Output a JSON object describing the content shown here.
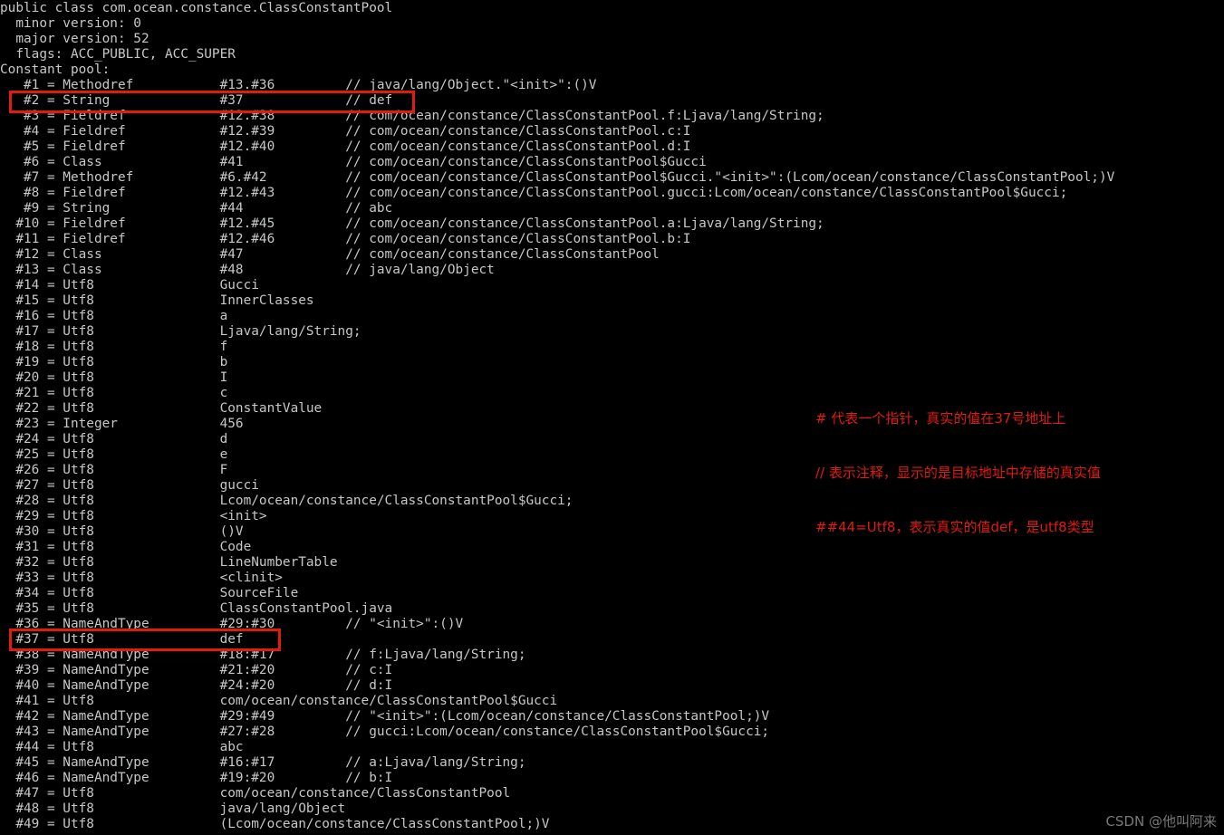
{
  "terminal": {
    "background_color": "#000000",
    "text_color": "#c5c8c6",
    "header_lines": [
      "public class com.ocean.constance.ClassConstantPool",
      "  minor version: 0",
      "  major version: 52",
      "  flags: ACC_PUBLIC, ACC_SUPER",
      "Constant pool:"
    ],
    "constant_pool": [
      {
        "index": "#1",
        "type": "Methodref",
        "ref": "#13.#36",
        "comment": "// java/lang/Object.\"<init>\":()V"
      },
      {
        "index": "#2",
        "type": "String",
        "ref": "#37",
        "comment": "// def"
      },
      {
        "index": "#3",
        "type": "Fieldref",
        "ref": "#12.#38",
        "comment": "// com/ocean/constance/ClassConstantPool.f:Ljava/lang/String;"
      },
      {
        "index": "#4",
        "type": "Fieldref",
        "ref": "#12.#39",
        "comment": "// com/ocean/constance/ClassConstantPool.c:I"
      },
      {
        "index": "#5",
        "type": "Fieldref",
        "ref": "#12.#40",
        "comment": "// com/ocean/constance/ClassConstantPool.d:I"
      },
      {
        "index": "#6",
        "type": "Class",
        "ref": "#41",
        "comment": "// com/ocean/constance/ClassConstantPool$Gucci"
      },
      {
        "index": "#7",
        "type": "Methodref",
        "ref": "#6.#42",
        "comment": "// com/ocean/constance/ClassConstantPool$Gucci.\"<init>\":(Lcom/ocean/constance/ClassConstantPool;)V"
      },
      {
        "index": "#8",
        "type": "Fieldref",
        "ref": "#12.#43",
        "comment": "// com/ocean/constance/ClassConstantPool.gucci:Lcom/ocean/constance/ClassConstantPool$Gucci;"
      },
      {
        "index": "#9",
        "type": "String",
        "ref": "#44",
        "comment": "// abc"
      },
      {
        "index": "#10",
        "type": "Fieldref",
        "ref": "#12.#45",
        "comment": "// com/ocean/constance/ClassConstantPool.a:Ljava/lang/String;"
      },
      {
        "index": "#11",
        "type": "Fieldref",
        "ref": "#12.#46",
        "comment": "// com/ocean/constance/ClassConstantPool.b:I"
      },
      {
        "index": "#12",
        "type": "Class",
        "ref": "#47",
        "comment": "// com/ocean/constance/ClassConstantPool"
      },
      {
        "index": "#13",
        "type": "Class",
        "ref": "#48",
        "comment": "// java/lang/Object"
      },
      {
        "index": "#14",
        "type": "Utf8",
        "ref": "Gucci",
        "comment": ""
      },
      {
        "index": "#15",
        "type": "Utf8",
        "ref": "InnerClasses",
        "comment": ""
      },
      {
        "index": "#16",
        "type": "Utf8",
        "ref": "a",
        "comment": ""
      },
      {
        "index": "#17",
        "type": "Utf8",
        "ref": "Ljava/lang/String;",
        "comment": ""
      },
      {
        "index": "#18",
        "type": "Utf8",
        "ref": "f",
        "comment": ""
      },
      {
        "index": "#19",
        "type": "Utf8",
        "ref": "b",
        "comment": ""
      },
      {
        "index": "#20",
        "type": "Utf8",
        "ref": "I",
        "comment": ""
      },
      {
        "index": "#21",
        "type": "Utf8",
        "ref": "c",
        "comment": ""
      },
      {
        "index": "#22",
        "type": "Utf8",
        "ref": "ConstantValue",
        "comment": ""
      },
      {
        "index": "#23",
        "type": "Integer",
        "ref": "456",
        "comment": ""
      },
      {
        "index": "#24",
        "type": "Utf8",
        "ref": "d",
        "comment": ""
      },
      {
        "index": "#25",
        "type": "Utf8",
        "ref": "e",
        "comment": ""
      },
      {
        "index": "#26",
        "type": "Utf8",
        "ref": "F",
        "comment": ""
      },
      {
        "index": "#27",
        "type": "Utf8",
        "ref": "gucci",
        "comment": ""
      },
      {
        "index": "#28",
        "type": "Utf8",
        "ref": "Lcom/ocean/constance/ClassConstantPool$Gucci;",
        "comment": ""
      },
      {
        "index": "#29",
        "type": "Utf8",
        "ref": "<init>",
        "comment": ""
      },
      {
        "index": "#30",
        "type": "Utf8",
        "ref": "()V",
        "comment": ""
      },
      {
        "index": "#31",
        "type": "Utf8",
        "ref": "Code",
        "comment": ""
      },
      {
        "index": "#32",
        "type": "Utf8",
        "ref": "LineNumberTable",
        "comment": ""
      },
      {
        "index": "#33",
        "type": "Utf8",
        "ref": "<clinit>",
        "comment": ""
      },
      {
        "index": "#34",
        "type": "Utf8",
        "ref": "SourceFile",
        "comment": ""
      },
      {
        "index": "#35",
        "type": "Utf8",
        "ref": "ClassConstantPool.java",
        "comment": ""
      },
      {
        "index": "#36",
        "type": "NameAndType",
        "ref": "#29:#30",
        "comment": "// \"<init>\":()V"
      },
      {
        "index": "#37",
        "type": "Utf8",
        "ref": "def",
        "comment": ""
      },
      {
        "index": "#38",
        "type": "NameAndType",
        "ref": "#18:#17",
        "comment": "// f:Ljava/lang/String;"
      },
      {
        "index": "#39",
        "type": "NameAndType",
        "ref": "#21:#20",
        "comment": "// c:I"
      },
      {
        "index": "#40",
        "type": "NameAndType",
        "ref": "#24:#20",
        "comment": "// d:I"
      },
      {
        "index": "#41",
        "type": "Utf8",
        "ref": "com/ocean/constance/ClassConstantPool$Gucci",
        "comment": ""
      },
      {
        "index": "#42",
        "type": "NameAndType",
        "ref": "#29:#49",
        "comment": "// \"<init>\":(Lcom/ocean/constance/ClassConstantPool;)V"
      },
      {
        "index": "#43",
        "type": "NameAndType",
        "ref": "#27:#28",
        "comment": "// gucci:Lcom/ocean/constance/ClassConstantPool$Gucci;"
      },
      {
        "index": "#44",
        "type": "Utf8",
        "ref": "abc",
        "comment": ""
      },
      {
        "index": "#45",
        "type": "NameAndType",
        "ref": "#16:#17",
        "comment": "// a:Ljava/lang/String;"
      },
      {
        "index": "#46",
        "type": "NameAndType",
        "ref": "#19:#20",
        "comment": "// b:I"
      },
      {
        "index": "#47",
        "type": "Utf8",
        "ref": "com/ocean/constance/ClassConstantPool",
        "comment": ""
      },
      {
        "index": "#48",
        "type": "Utf8",
        "ref": "java/lang/Object",
        "comment": ""
      },
      {
        "index": "#49",
        "type": "Utf8",
        "ref": "(Lcom/ocean/constance/ClassConstantPool;)V",
        "comment": ""
      }
    ]
  },
  "highlights": {
    "color": "#e01b10",
    "boxes": [
      {
        "target": "#2 = String",
        "label": "string-2-row"
      },
      {
        "target": "#37 = Utf8",
        "label": "utf8-37-row"
      }
    ]
  },
  "annotation": {
    "color": "#e01b10",
    "lines": [
      "# 代表一个指针，真实的值在37号地址上",
      "// 表示注释，显示的是目标地址中存储的真实值",
      "##44=Utf8，表示真实的值def，是utf8类型"
    ]
  },
  "watermark": {
    "text": "CSDN @他叫阿来"
  }
}
